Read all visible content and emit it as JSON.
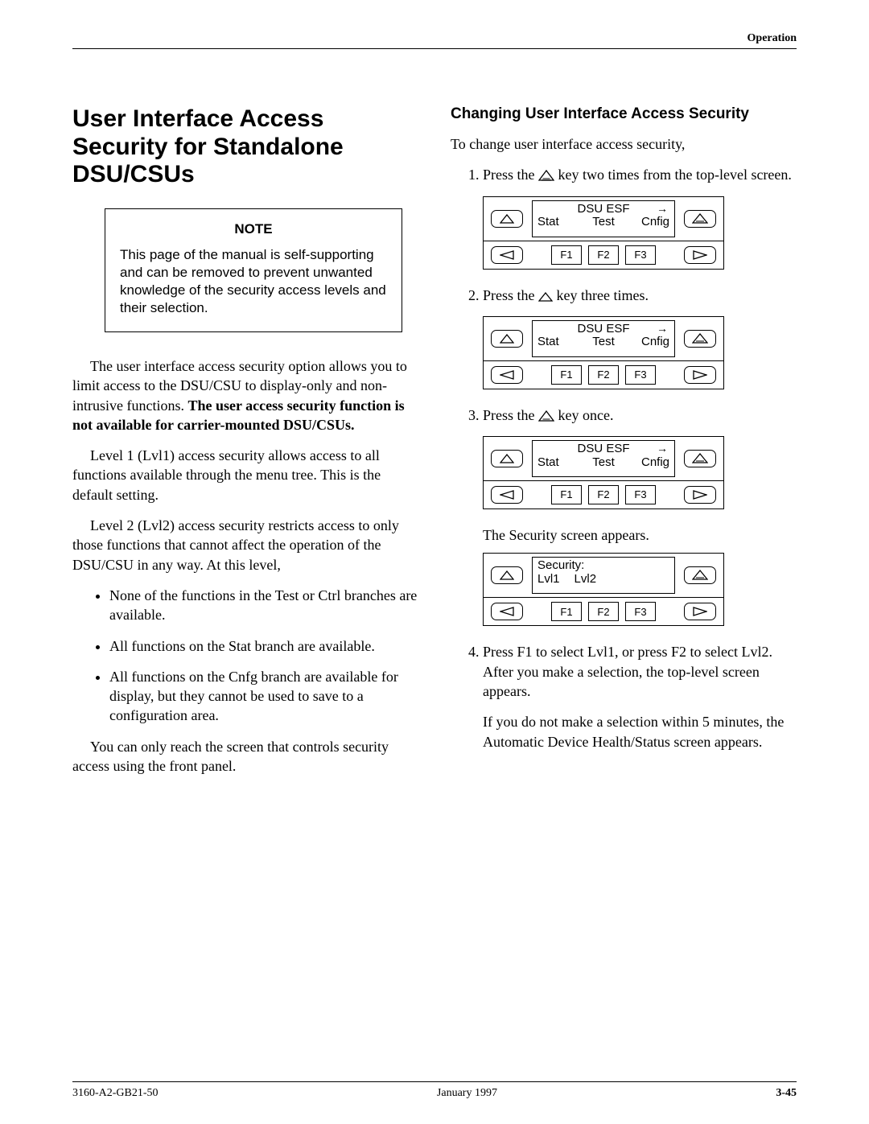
{
  "header": {
    "running_head": "Operation"
  },
  "left": {
    "title": "User Interface Access Security for Standalone DSU/CSUs",
    "note": {
      "label": "NOTE",
      "text": "This page of the manual is self-supporting and can be removed to prevent unwanted knowledge of the security access levels and their selection."
    },
    "p1_a": "The user interface access security option allows you to limit access to the DSU/CSU to display-only and non-intrusive functions. ",
    "p1_b_bold": "The user access security function is not available for carrier-mounted DSU/CSUs.",
    "p2": "Level 1 (Lvl1) access security allows access to all functions available through the menu tree. This is the default setting.",
    "p3": "Level 2 (Lvl2) access security restricts access to only those functions that cannot affect the operation of the DSU/CSU in any way. At this level,",
    "bullets": [
      "None of the functions in the Test or Ctrl branches are available.",
      "All functions on the Stat branch are available.",
      "All functions on the Cnfg branch are available for display, but they cannot be used to save to a configuration area."
    ],
    "p4": "You can only reach the screen that controls security access using the front panel."
  },
  "right": {
    "subhead": "Changing User Interface Access Security",
    "intro": "To change user interface access security,",
    "steps": {
      "s1_a": "Press the ",
      "s1_b": " key two times from the top-level screen.",
      "s2_a": "Press the ",
      "s2_b": " key three times.",
      "s3_a": "Press the ",
      "s3_b": " key once.",
      "security_appears": "The Security screen appears.",
      "s4_a": "Press F1 to select Lvl1, or press F2 to select Lvl2. After you make a selection, the top-level screen appears.",
      "s4_b": "If you do not make a selection within 5 minutes, the Automatic Device Health/Status screen appears."
    }
  },
  "panel_common": {
    "lcd_title": "DSU ESF",
    "stat": "Stat",
    "test": "Test",
    "cnfig": "Cnfig",
    "f1": "F1",
    "f2": "F2",
    "f3": "F3"
  },
  "panel_security": {
    "top": "Security:",
    "lvl1": "Lvl1",
    "lvl2": "Lvl2"
  },
  "footer": {
    "left": "3160-A2-GB21-50",
    "center": "January 1997",
    "right": "3-45"
  }
}
